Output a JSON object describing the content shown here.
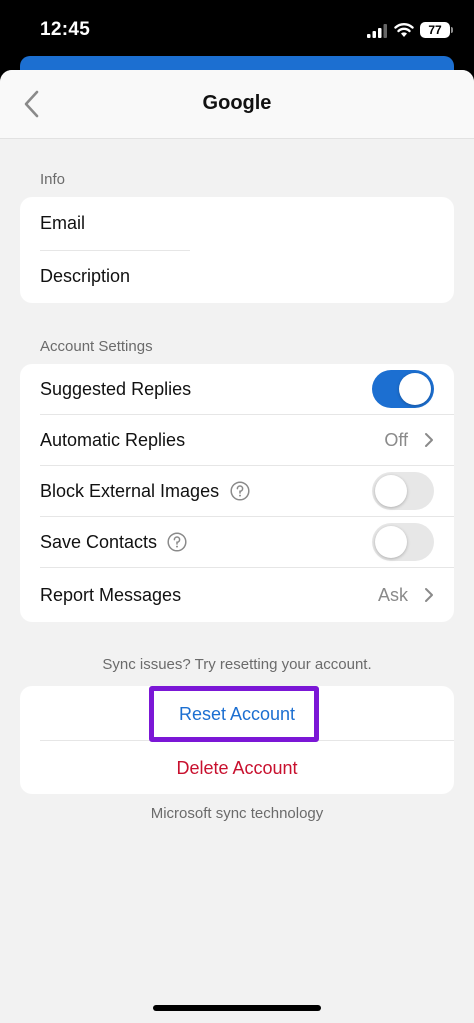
{
  "status_bar": {
    "time": "12:45",
    "battery": "77"
  },
  "nav": {
    "title": "Google"
  },
  "info": {
    "header": "Info",
    "items": [
      {
        "label": "Email"
      },
      {
        "label": "Description"
      }
    ]
  },
  "account_settings": {
    "header": "Account Settings",
    "suggested_replies": {
      "label": "Suggested Replies",
      "enabled": true
    },
    "automatic_replies": {
      "label": "Automatic Replies",
      "value": "Off"
    },
    "block_external_images": {
      "label": "Block External Images",
      "enabled": false
    },
    "save_contacts": {
      "label": "Save Contacts",
      "enabled": false
    },
    "report_messages": {
      "label": "Report Messages",
      "value": "Ask"
    }
  },
  "sync": {
    "hint": "Sync issues? Try resetting your account.",
    "reset_label": "Reset Account",
    "delete_label": "Delete Account",
    "footer": "Microsoft sync technology"
  },
  "colors": {
    "accent": "#1c6fd1",
    "danger": "#c8102e",
    "highlight": "#7b17d6"
  }
}
